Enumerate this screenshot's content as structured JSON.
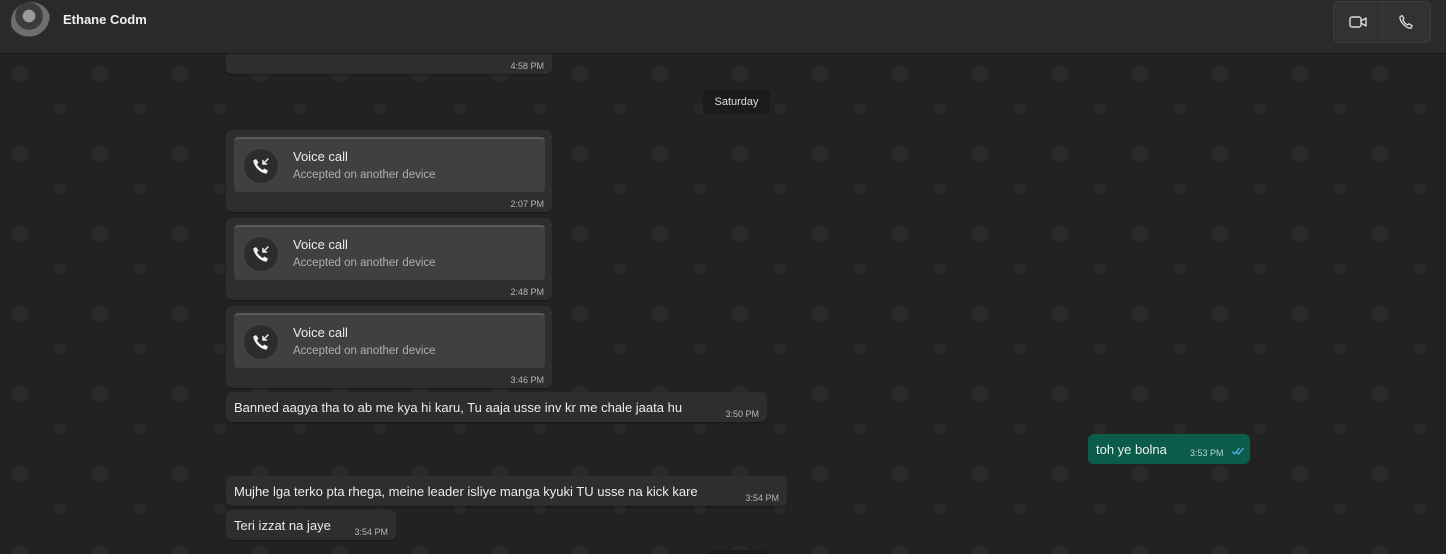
{
  "header": {
    "contact_name": "Ethane Codm",
    "icons": [
      "avatar",
      "video-call-icon",
      "voice-call-icon"
    ]
  },
  "chat": {
    "top_partial_time": "4:58 PM",
    "date_label": "Saturday",
    "calls": [
      {
        "title": "Voice call",
        "status": "Accepted on another device",
        "time": "2:07 PM",
        "icon": "incoming-call-icon"
      },
      {
        "title": "Voice call",
        "status": "Accepted on another device",
        "time": "2:48 PM",
        "icon": "incoming-call-icon"
      },
      {
        "title": "Voice call",
        "status": "Accepted on another device",
        "time": "3:46 PM",
        "icon": "incoming-call-icon"
      }
    ],
    "messages": [
      {
        "direction": "in",
        "text": "Banned aagya tha to ab me kya hi karu, Tu aaja usse inv kr me chale jaata hu",
        "time": "3:50 PM"
      },
      {
        "direction": "out",
        "text": "toh ye bolna",
        "time": "3:53 PM",
        "status": "read"
      },
      {
        "direction": "in",
        "text": "Mujhe lga terko pta rhega, meine leader isliye manga kyuki TU usse na kick kare",
        "time": "3:54 PM"
      },
      {
        "direction": "in",
        "text": "Teri izzat na jaye",
        "time": "3:54 PM"
      }
    ]
  },
  "colors": {
    "background": "#222222",
    "incoming_bubble": "#2e2e2e",
    "outgoing_bubble": "#0b5c4a",
    "read_ticks": "#53bdeb"
  }
}
